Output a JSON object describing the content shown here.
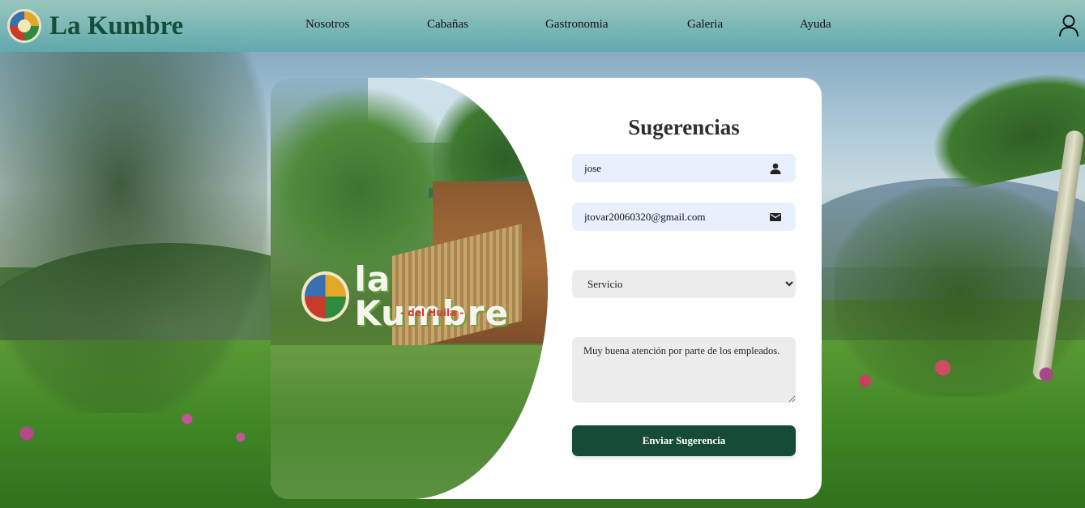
{
  "brand": {
    "name": "La Kumbre"
  },
  "nav": {
    "items": [
      {
        "label": "Nosotros"
      },
      {
        "label": "Cabañas"
      },
      {
        "label": "Gastronomia"
      },
      {
        "label": "Galeria"
      },
      {
        "label": "Ayuda"
      }
    ]
  },
  "user": {
    "icon": "user-icon"
  },
  "photo": {
    "logo_text": "la Kumbre",
    "logo_subtext": "- del Huila -"
  },
  "form": {
    "title": "Sugerencias",
    "name": {
      "value": "jose",
      "icon": "person-icon"
    },
    "email": {
      "value": "jtovar20060320@gmail.com",
      "icon": "mail-icon"
    },
    "service": {
      "selected": "Servicio",
      "options": [
        "Servicio"
      ]
    },
    "message": {
      "value": "Muy buena atención por parte de los empleados."
    },
    "submit_label": "Enviar Sugerencia"
  },
  "colors": {
    "brand_green": "#164c3a",
    "navbar": "#5faab0",
    "input_blue": "#e8f0fe",
    "input_gray": "#ececec",
    "button": "#164c37"
  }
}
